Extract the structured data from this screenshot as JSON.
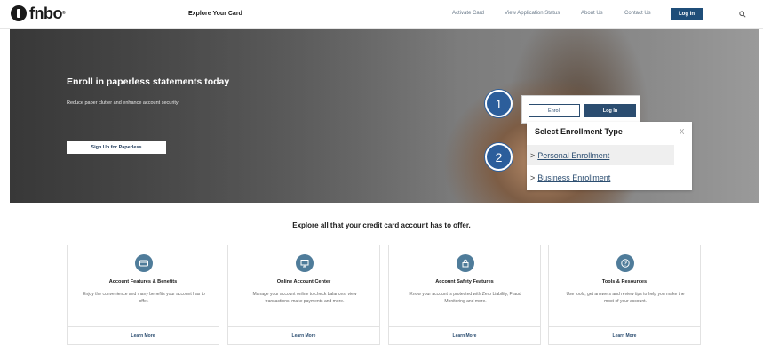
{
  "header": {
    "logo_text": "fnbo",
    "logo_reg": "®",
    "explore_link": "Explore Your Card",
    "nav": [
      "Activate Card",
      "View Application Status",
      "About Us",
      "Contact Us"
    ],
    "login_label": "Log In"
  },
  "hero": {
    "title": "Enroll in paperless statements today",
    "subtitle": "Reduce paper clutter and enhance account security",
    "button": "Sign Up for Paperless"
  },
  "popup": {
    "enroll_label": "Enroll",
    "login_label": "Log In",
    "dropdown_title": "Select Enrollment Type",
    "close_label": "X",
    "items": [
      {
        "arrow": ">",
        "label": "Personal Enrollment"
      },
      {
        "arrow": ">",
        "label": "Business Enrollment"
      }
    ]
  },
  "steps": [
    "1",
    "2"
  ],
  "section": {
    "title": "Explore all that your credit card account has to offer."
  },
  "cards": [
    {
      "icon": "credit-card-icon",
      "title": "Account Features & Benefits",
      "desc": "Enjoy the convenience and many benefits your account has to offer.",
      "link": "Learn More"
    },
    {
      "icon": "monitor-icon",
      "title": "Online Account Center",
      "desc": "Manage your account online to check balances, view transactions, make payments and more.",
      "link": "Learn More"
    },
    {
      "icon": "lock-icon",
      "title": "Account Safety Features",
      "desc": "Know your account is protected with Zero Liability, Fraud Monitoring and more.",
      "link": "Learn More"
    },
    {
      "icon": "question-icon",
      "title": "Tools & Resources",
      "desc": "Use tools, get answers and review tips to help you make the most of your account.",
      "link": "Learn More"
    }
  ],
  "colors": {
    "brand_navy": "#1f4e79",
    "step_blue": "#2c5e9b",
    "icon_teal": "#4f7c9a"
  }
}
